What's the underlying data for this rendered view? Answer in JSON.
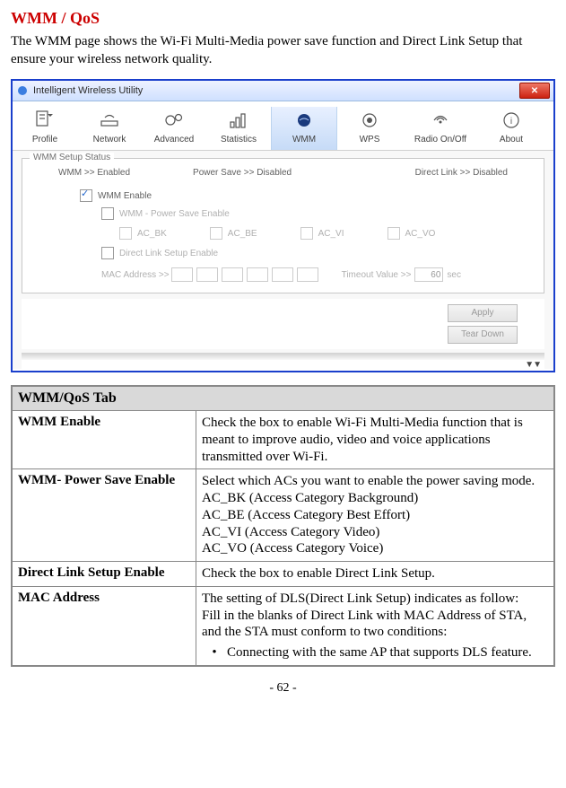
{
  "heading": "WMM / QoS",
  "intro": "The WMM page shows the Wi-Fi Multi-Media power save function and Direct Link Setup that ensure your wireless network quality.",
  "app": {
    "title": "Intelligent Wireless Utility",
    "close": "✕",
    "tabs": {
      "profile": "Profile",
      "network": "Network",
      "advanced": "Advanced",
      "statistics": "Statistics",
      "wmm": "WMM",
      "wps": "WPS",
      "radio": "Radio On/Off",
      "about": "About"
    },
    "group_title": "WMM Setup Status",
    "status": {
      "wmm": "WMM >>  Enabled",
      "ps": "Power Save >> Disabled",
      "dls": "Direct Link >> Disabled"
    },
    "cb": {
      "wmm_enable": "WMM Enable",
      "ps_enable": "WMM - Power Save Enable",
      "dls_enable": "Direct Link Setup Enable"
    },
    "ac": {
      "bk": "AC_BK",
      "be": "AC_BE",
      "vi": "AC_VI",
      "vo": "AC_VO"
    },
    "mac_label": "MAC Address >>",
    "timeout_label": "Timeout Value >>",
    "timeout_value": "60",
    "timeout_unit": "sec",
    "btn_apply": "Apply",
    "btn_teardown": "Tear Down"
  },
  "table": {
    "header": "WMM/QoS Tab",
    "rows": {
      "wmm_enable_label": "WMM Enable",
      "wmm_enable_desc": "Check the box to enable Wi-Fi Multi-Media function that is meant to improve audio, video and voice applications transmitted over Wi-Fi.",
      "ps_label": "WMM- Power Save Enable",
      "ps_desc_intro": "Select which ACs you want to enable the power saving mode.",
      "ps_bk": "AC_BK (Access Category Background)",
      "ps_be": "AC_BE (Access Category Best Effort)",
      "ps_vi": "AC_VI (Access Category Video)",
      "ps_vo": "AC_VO (Access Category Voice)",
      "dls_label": "Direct Link Setup Enable",
      "dls_desc": "Check the box to enable Direct Link Setup.",
      "mac_label": "MAC Address",
      "mac_intro": "The setting of DLS(Direct Link Setup) indicates as follow:",
      "mac_body": "Fill in the blanks of Direct Link with MAC Address of STA, and the STA must conform to two conditions:",
      "mac_bullet": "Connecting with the same AP that supports DLS feature."
    }
  },
  "page_number": "- 62 -"
}
